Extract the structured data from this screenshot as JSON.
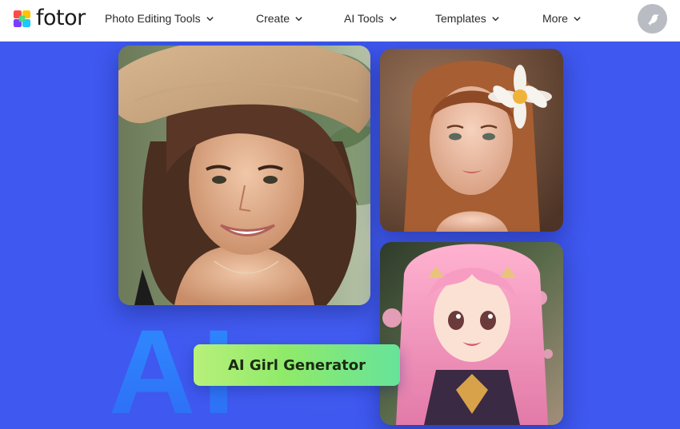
{
  "brand": {
    "name": "fotor"
  },
  "nav": {
    "items": [
      {
        "label": "Photo Editing Tools"
      },
      {
        "label": "Create"
      },
      {
        "label": "AI Tools"
      },
      {
        "label": "Templates"
      },
      {
        "label": "More"
      }
    ]
  },
  "hero": {
    "background_letters": "AI",
    "cta_label": "AI Girl Generator",
    "colors": {
      "background": "#3f58ef",
      "cta_start": "#b8f07a",
      "cta_end": "#66e39a"
    },
    "images": [
      {
        "subject": "photo-woman-sun-hat"
      },
      {
        "subject": "photo-girl-white-flower"
      },
      {
        "subject": "photo-anime-girl-pink-hair"
      }
    ]
  }
}
